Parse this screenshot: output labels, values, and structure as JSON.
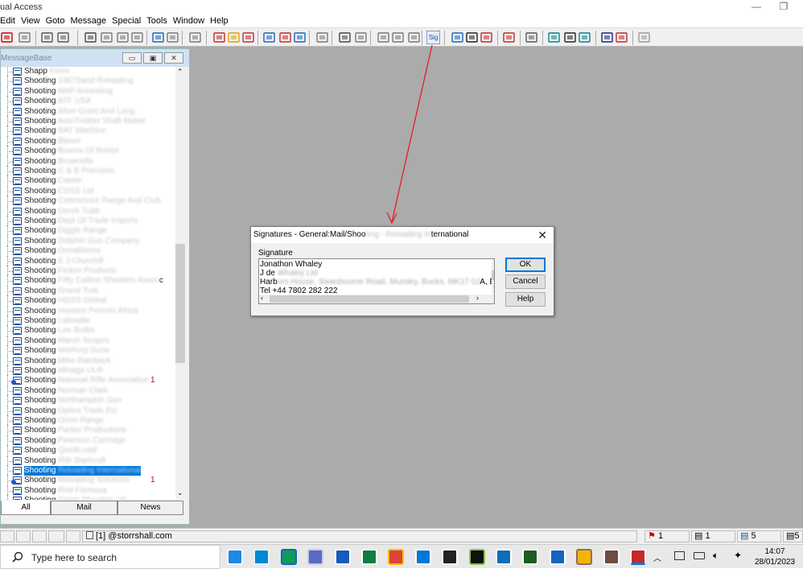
{
  "app": {
    "title": "ual Access"
  },
  "menu": [
    "Edit",
    "View",
    "Goto",
    "Message",
    "Special",
    "Tools",
    "Window",
    "Help"
  ],
  "toolbar": {
    "sig_label": "Sig"
  },
  "messagebase": {
    "title": "MessageBase",
    "rows": [
      {
        "prefix": "Shapp",
        "blurred": "Kevin"
      },
      {
        "prefix": "Shooting",
        "blurred": "1967Sand Reloading"
      },
      {
        "prefix": "Shooting",
        "blurred": "AMP Annealing"
      },
      {
        "prefix": "Shooting",
        "blurred": "ATF USA"
      },
      {
        "prefix": "Shooting",
        "blurred": "Alton Grant And Long"
      },
      {
        "prefix": "Shooting",
        "blurred": "AutoTrickler Shaft Maker"
      },
      {
        "prefix": "Shooting",
        "blurred": "BAT Machine"
      },
      {
        "prefix": "Shooting",
        "blurred": "Blaser"
      },
      {
        "prefix": "Shooting",
        "blurred": "Braces Of Bristol"
      },
      {
        "prefix": "Shooting",
        "blurred": "Brownells"
      },
      {
        "prefix": "Shooting",
        "blurred": "C & B Precision"
      },
      {
        "prefix": "Shooting",
        "blurred": "Caster"
      },
      {
        "prefix": "Shooting",
        "blurred": "CDSS Ltd"
      },
      {
        "prefix": "Shooting",
        "blurred": "Cottesmore Range And Club"
      },
      {
        "prefix": "Shooting",
        "blurred": "Derek Tubb"
      },
      {
        "prefix": "Shooting",
        "blurred": "Dept Of Trade Imports"
      },
      {
        "prefix": "Shooting",
        "blurred": "Diggle Range"
      },
      {
        "prefix": "Shooting",
        "blurred": "Dolphin Gun Company"
      },
      {
        "prefix": "Shooting",
        "blurred": "Donaldsons"
      },
      {
        "prefix": "Shooting",
        "blurred": "E J Churchill"
      },
      {
        "prefix": "Shooting",
        "blurred": "Fiction Products"
      },
      {
        "prefix": "Shooting",
        "blurred": "Fifty Calibre Shooters Assoc",
        "suffix": "c"
      },
      {
        "prefix": "Shooting",
        "blurred": "Grand Trek"
      },
      {
        "prefix": "Shooting",
        "blurred": "HGSS Global"
      },
      {
        "prefix": "Shooting",
        "blurred": "Hunters Permits Africa"
      },
      {
        "prefix": "Shooting",
        "blurred": "Labradar"
      },
      {
        "prefix": "Shooting",
        "blurred": "Lee Butler"
      },
      {
        "prefix": "Shooting",
        "blurred": "March Scopes"
      },
      {
        "prefix": "Shooting",
        "blurred": "Morhorp Guns"
      },
      {
        "prefix": "Shooting",
        "blurred": "Mike Rainback"
      },
      {
        "prefix": "Shooting",
        "blurred": "Minage ULR"
      },
      {
        "prefix": "Shooting",
        "blurred": "National Rifle Association",
        "count": "1",
        "icon": "newmail"
      },
      {
        "prefix": "Shooting",
        "blurred": "Norman Clark"
      },
      {
        "prefix": "Shooting",
        "blurred": "Northampton Gun"
      },
      {
        "prefix": "Shooting",
        "blurred": "Optics Trade EU"
      },
      {
        "prefix": "Shooting",
        "blurred": "Orion Range"
      },
      {
        "prefix": "Shooting",
        "blurred": "Parker Productions"
      },
      {
        "prefix": "Shooting",
        "blurred": "Peterson Cartridge"
      },
      {
        "prefix": "Shooting",
        "blurred": "QuickLoad"
      },
      {
        "prefix": "Shooting",
        "blurred": "RW Starlcraft"
      },
      {
        "prefix": "Shooting",
        "blurred": "Reloading International",
        "selected": true
      },
      {
        "prefix": "Shooting",
        "blurred": "Reloading Solutions",
        "count": "1",
        "icon": "newmail"
      },
      {
        "prefix": "Shooting",
        "blurred": "Rod Formosa"
      },
      {
        "prefix": "Shooting",
        "blurred": "Storm Shooting UK"
      }
    ],
    "tabs": [
      "All",
      "Mail",
      "News"
    ]
  },
  "statusbar": {
    "account": "[1] @storrshall.com",
    "count1": "1",
    "count2": "1",
    "count3": "5",
    "count4": "5"
  },
  "taskbar": {
    "search_placeholder": "Type here to search",
    "time": "14:07",
    "date": "28/01/2023"
  },
  "dialog": {
    "title_prefix": "Signatures - General:Mail/Shoo",
    "title_blurred": "ting - Reloading In",
    "title_suffix": "ternational",
    "label": "Signature",
    "lines": [
      {
        "text": "Jonathon Whaley"
      },
      {
        "text": "J de ",
        "blurred": "Whaley Ltd"
      },
      {
        "text": "Harb",
        "blurred": "ors House, Swanbourne Road, Mursley, Bucks, MK17 0J",
        "suffix": "A, ENGLAND"
      },
      {
        "text": "Tel +44 7802 282 222"
      }
    ],
    "ok": "OK",
    "cancel": "Cancel",
    "help": "Help"
  },
  "colors": {
    "accent": "#0078d7",
    "arrow": "#e0202a",
    "workspace": "#ababab"
  }
}
